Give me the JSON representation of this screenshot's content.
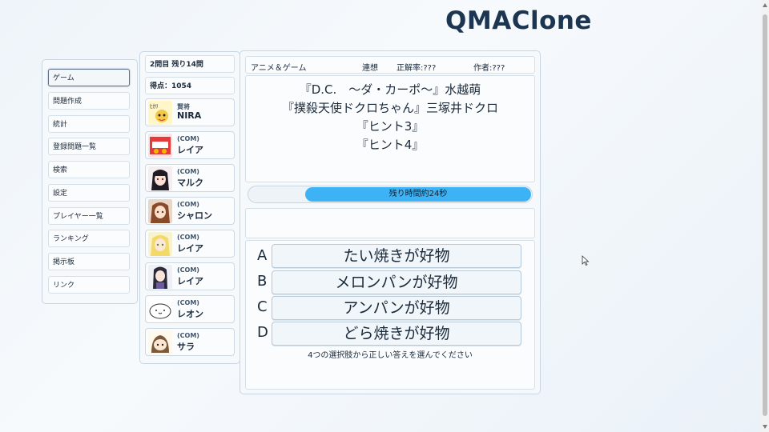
{
  "app": {
    "title": "QMAClone"
  },
  "menu": {
    "items": [
      {
        "label": "ゲーム",
        "active": true
      },
      {
        "label": "問題作成"
      },
      {
        "label": "統計"
      },
      {
        "label": "登録問題一覧"
      },
      {
        "label": "検索"
      },
      {
        "label": "設定"
      },
      {
        "label": "プレイヤー一覧"
      },
      {
        "label": "ランキング"
      },
      {
        "label": "掲示板"
      },
      {
        "label": "リンク"
      }
    ]
  },
  "status": {
    "round": "2問目 残り14問",
    "score": "得点：1054"
  },
  "players": [
    {
      "tag": "賢将",
      "name": "NIRA",
      "avatar_icon": "hikari-text-icon"
    },
    {
      "tag": "(COM)",
      "name": "レイア",
      "avatar_icon": "strawberry-icon"
    },
    {
      "tag": "(COM)",
      "name": "マルク",
      "avatar_icon": "anime-girl-icon"
    },
    {
      "tag": "(COM)",
      "name": "シャロン",
      "avatar_icon": "anime-girl-icon"
    },
    {
      "tag": "(COM)",
      "name": "レイア",
      "avatar_icon": "anime-girl-icon"
    },
    {
      "tag": "(COM)",
      "name": "レイア",
      "avatar_icon": "anime-girl-icon"
    },
    {
      "tag": "(COM)",
      "name": "レオン",
      "avatar_icon": "blob-face-icon"
    },
    {
      "tag": "(COM)",
      "name": "サラ",
      "avatar_icon": "chibi-girl-icon"
    }
  ],
  "question": {
    "genre": "アニメ＆ゲーム",
    "type": "連想",
    "accuracy": "正解率:???",
    "author": "作者:???",
    "lines": [
      "『D.C.　～ダ・カーポ～』水越萌",
      "『撲殺天使ドクロちゃん』三塚井ドクロ",
      "『ヒント3』",
      "『ヒント4』"
    ]
  },
  "timer": {
    "label": "残り時間約24秒",
    "remaining_fraction": 0.8
  },
  "choices": [
    {
      "letter": "A",
      "text": "たい焼きが好物"
    },
    {
      "letter": "B",
      "text": "メロンパンが好物"
    },
    {
      "letter": "C",
      "text": "アンパンが好物"
    },
    {
      "letter": "D",
      "text": "どら焼きが好物"
    }
  ],
  "instruction": "4つの選択肢から正しい答えを選んでください",
  "colors": {
    "accent": "#3db3f5",
    "title": "#1c3550"
  }
}
